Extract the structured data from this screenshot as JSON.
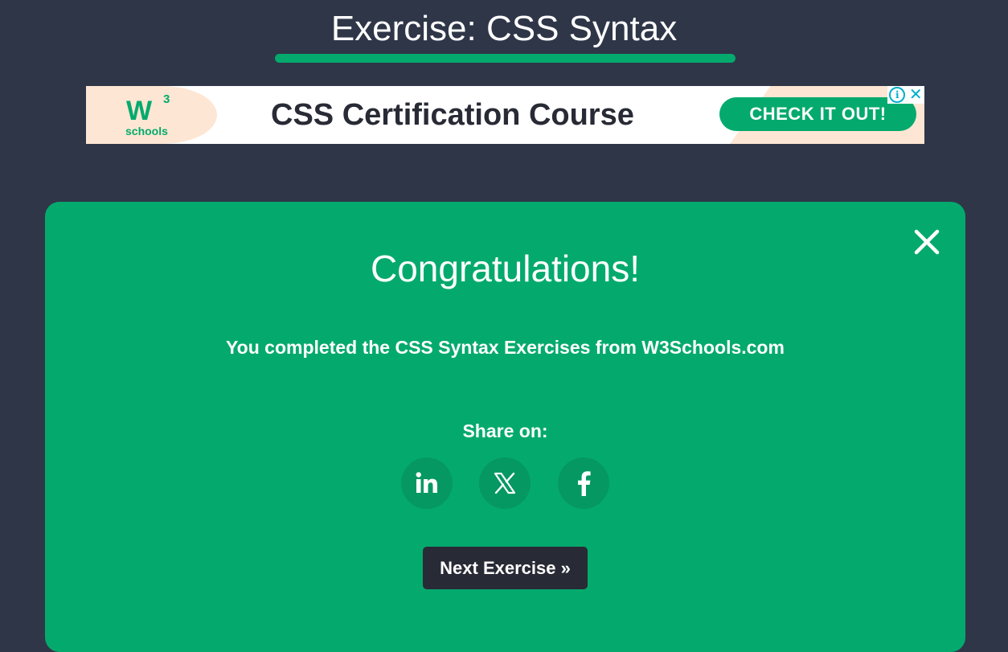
{
  "header": {
    "title": "Exercise: CSS Syntax"
  },
  "ad": {
    "logo_mark": "W",
    "logo_superscript": "3",
    "logo_text": "schools",
    "headline": "CSS Certification Course",
    "cta_label": "CHECK IT OUT!",
    "choices_info_icon": "info-icon",
    "choices_close_icon": "close-icon"
  },
  "modal": {
    "title": "Congratulations!",
    "message": "You completed the CSS Syntax Exercises from W3Schools.com",
    "share_label": "Share on:",
    "share_buttons": [
      {
        "name": "linkedin",
        "icon": "linkedin-icon"
      },
      {
        "name": "x",
        "icon": "x-icon"
      },
      {
        "name": "facebook",
        "icon": "facebook-icon"
      }
    ],
    "next_label": "Next Exercise »",
    "close_icon": "close-icon"
  },
  "colors": {
    "page_background": "#2f3648",
    "accent_green": "#04aa6d",
    "share_button_bg": "#059862",
    "next_button_bg": "#282a35",
    "text_white": "#ffffff"
  }
}
